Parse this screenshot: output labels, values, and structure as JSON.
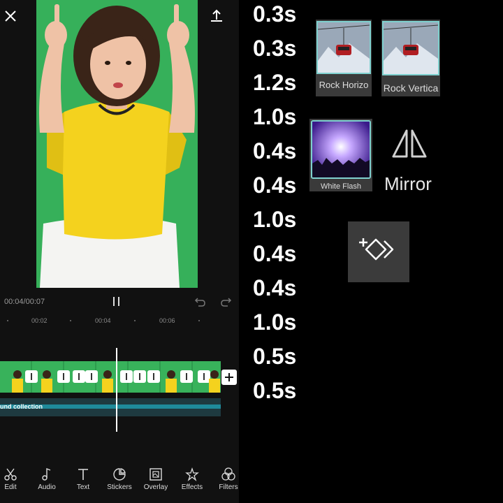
{
  "preview": {
    "timecode": "00:04/00:07"
  },
  "ruler": {
    "ticks": [
      "00:02",
      "00:04",
      "00:06"
    ]
  },
  "audio": {
    "label": "und collection"
  },
  "toolbar": {
    "items": [
      {
        "label": "Edit",
        "icon": "scissors-icon"
      },
      {
        "label": "Audio",
        "icon": "music-note-icon"
      },
      {
        "label": "Text",
        "icon": "text-icon"
      },
      {
        "label": "Stickers",
        "icon": "sticker-icon"
      },
      {
        "label": "Overlay",
        "icon": "overlay-icon"
      },
      {
        "label": "Effects",
        "icon": "effects-sparkle-icon"
      },
      {
        "label": "Filters",
        "icon": "filters-icon"
      }
    ]
  },
  "durations": [
    "0.3s",
    "0.3s",
    "1.2s",
    "1.0s",
    "0.4s",
    "0.4s",
    "1.0s",
    "0.4s",
    "0.4s",
    "1.0s",
    "0.5s",
    "0.5s"
  ],
  "effects": {
    "rock_horizontal": "Rock Horizo",
    "rock_vertical": "Rock Vertica",
    "white_flash": "White Flash",
    "mirror": "Mirror"
  },
  "colors": {
    "accent_border": "#7fd1cf",
    "screen_green": "#35b35c",
    "shirt_yellow": "#f4d21e"
  }
}
